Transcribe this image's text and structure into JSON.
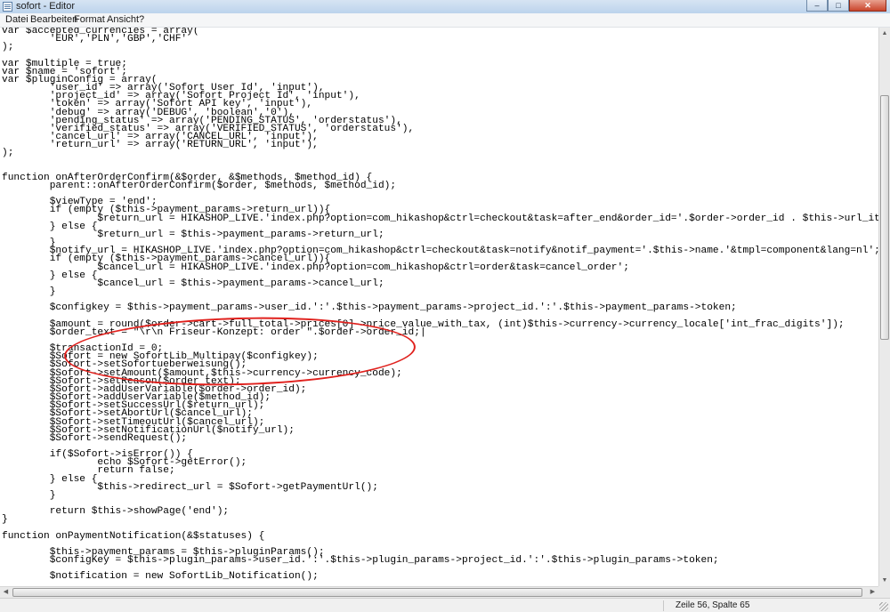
{
  "window": {
    "title": "sofort - Editor",
    "buttons": {
      "minimize": "–",
      "maximize": "□",
      "close": "✕"
    }
  },
  "menu": {
    "items": [
      {
        "label": "Datei"
      },
      {
        "label": "Bearbeiten"
      },
      {
        "label": "Format"
      },
      {
        "label": "Ansicht"
      },
      {
        "label": "?"
      }
    ]
  },
  "editor": {
    "code": "var $accepted_currencies = array(\n        'EUR','PLN','GBP','CHF'\n);\n\nvar $multiple = true;\nvar $name = 'sofort';\nvar $pluginConfig = array(\n        'user_id' => array('Sofort User Id', 'input'),\n        'project_id' => array('Sofort Project Id', 'input'),\n        'token' => array('Sofort API key', 'input'),\n        'debug' => array('DEBUG', 'boolean','0'),\n        'pending_status' => array('PENDING_STATUS', 'orderstatus'),\n        'verified_status' => array('VERIFIED_STATUS', 'orderstatus'),\n        'cancel_url' => array('CANCEL_URL', 'input'),\n        'return_url' => array('RETURN_URL', 'input'),\n);\n\n\nfunction onAfterOrderConfirm(&$order, &$methods, $method_id) {\n        parent::onAfterOrderConfirm($order, $methods, $method_id);\n\n        $viewType = 'end';\n        if (empty ($this->payment_params->return_url)){\n                $return_url = HIKASHOP_LIVE.'index.php?option=com_hikashop&ctrl=checkout&task=after_end&order_id='.$order->order_id . $this->url_itemid;\n        } else {\n                $return_url = $this->payment_params->return_url;\n        }\n        $notify_url = HIKASHOP_LIVE.'index.php?option=com_hikashop&ctrl=checkout&task=notify&notif_payment='.$this->name.'&tmpl=component&lang=nl';\n        if (empty ($this->payment_params->cancel_url)){\n                $cancel_url = HIKASHOP_LIVE.'index.php?option=com_hikashop&ctrl=order&task=cancel_order';\n        } else {\n                $cancel_url = $this->payment_params->cancel_url;\n        }\n\n        $configkey = $this->payment_params->user_id.':'.$this->payment_params->project_id.':'.$this->payment_params->token;\n\n        $amount = round($order->cart->full_total->prices[0]->price_value_with_tax, (int)$this->currency->currency_locale['int_frac_digits']);\n        $order_text = \"\\r\\n Friseur-Konzept: order \".$order->order_id;|\n\n        $transactionId = 0;\n        $Sofort = new SofortLib_Multipay($configkey);\n        $Sofort->setSofortueberweisung();\n        $Sofort->setAmount($amount,$this->currency->currency_code);\n        $Sofort->setReason($order_text);\n        $Sofort->addUserVariable($order->order_id);\n        $Sofort->addUserVariable($method_id);\n        $Sofort->setSuccessUrl($return_url);\n        $Sofort->setAbortUrl($cancel_url);\n        $Sofort->setTimeoutUrl($cancel_url);\n        $Sofort->setNotificationUrl($notify_url);\n        $Sofort->sendRequest();\n\n        if($Sofort->isError()) {\n                echo $Sofort->getError();\n                return false;\n        } else {\n                $this->redirect_url = $Sofort->getPaymentUrl();\n        }\n\n        return $this->showPage('end');\n}\n\nfunction onPaymentNotification(&$statuses) {\n\n        $this->payment_params = $this->pluginParams();\n        $configKey = $this->plugin_params->user_id.':'.$this->plugin_params->project_id.':'.$this->plugin_params->token;\n\n        $notification = new SofortLib_Notification();"
  },
  "statusbar": {
    "position": "Zeile 56, Spalte 65"
  },
  "colors": {
    "highlight": "#e0211d",
    "titlebar": "#bcd3ec",
    "close_button": "#c9452c"
  }
}
